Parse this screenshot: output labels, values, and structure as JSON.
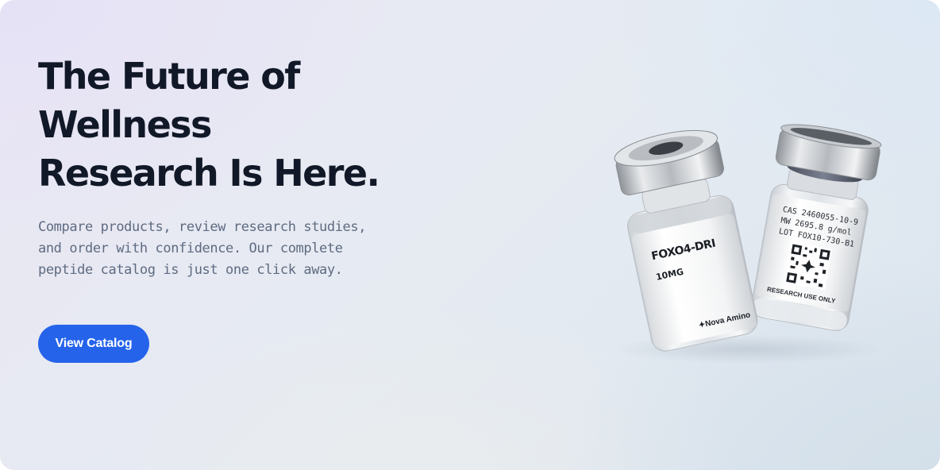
{
  "hero": {
    "headline_lines": [
      "The Future of",
      "Wellness",
      "Research Is Here."
    ],
    "subtext_lines": [
      "Compare products, review research studies,",
      "and order with confidence. Our complete",
      "peptide catalog is just one click away."
    ],
    "cta_label": "View Catalog"
  },
  "product_image": {
    "front_vial": {
      "name": "FOXO4-DRI",
      "dose": "10MG",
      "brand": "✦Nova Amino"
    },
    "back_vial": {
      "cas": "CAS 2460055-10-9",
      "mw": "MW 2695.8 g/mol",
      "lot": "LOT FOX10-730-B1",
      "footer": "RESEARCH USE ONLY"
    }
  },
  "colors": {
    "accent": "#2563eb",
    "headline": "#111827",
    "subtext": "#5e6b80"
  }
}
